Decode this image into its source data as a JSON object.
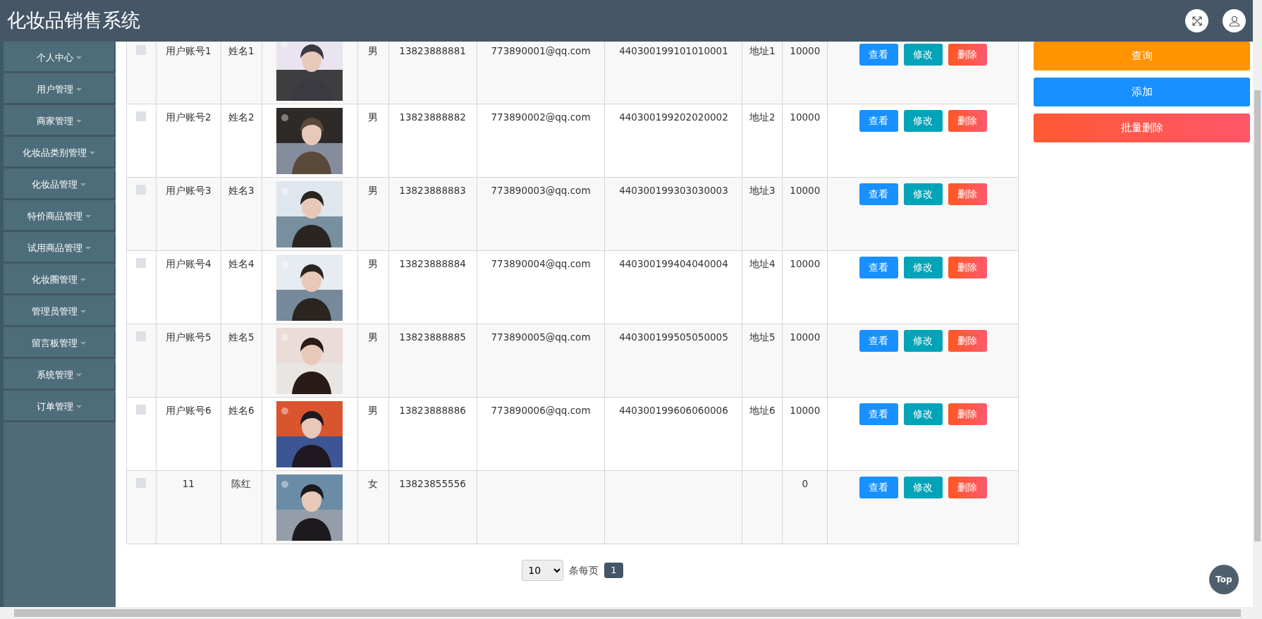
{
  "header": {
    "title": "化妆品销售系统"
  },
  "sidebar": {
    "items": [
      {
        "label": "个人中心"
      },
      {
        "label": "用户管理"
      },
      {
        "label": "商家管理"
      },
      {
        "label": "化妆品类别管理"
      },
      {
        "label": "化妆品管理"
      },
      {
        "label": "特价商品管理"
      },
      {
        "label": "试用商品管理"
      },
      {
        "label": "化妆圈管理"
      },
      {
        "label": "管理员管理"
      },
      {
        "label": "留言板管理"
      },
      {
        "label": "系统管理"
      },
      {
        "label": "订单管理"
      }
    ]
  },
  "table": {
    "rows": [
      {
        "checked": false,
        "account": "用户账号1",
        "name": "姓名1",
        "gender": "男",
        "phone": "13823888881",
        "email": "773890001@qq.com",
        "id_number": "440300199101010001",
        "address": "地址1",
        "column_10": "10000",
        "actions": [
          {
            "label": "查看",
            "kind": "view"
          },
          {
            "label": "修改",
            "kind": "edit"
          },
          {
            "label": "删除",
            "kind": "delete"
          }
        ]
      },
      {
        "checked": false,
        "account": "用户账号2",
        "name": "姓名2",
        "gender": "男",
        "phone": "13823888882",
        "email": "773890002@qq.com",
        "id_number": "440300199202020002",
        "address": "地址2",
        "column_10": "10000",
        "actions": [
          {
            "label": "查看",
            "kind": "view"
          },
          {
            "label": "修改",
            "kind": "edit"
          },
          {
            "label": "删除",
            "kind": "delete"
          }
        ]
      },
      {
        "checked": false,
        "account": "用户账号3",
        "name": "姓名3",
        "gender": "男",
        "phone": "13823888883",
        "email": "773890003@qq.com",
        "id_number": "440300199303030003",
        "address": "地址3",
        "column_10": "10000",
        "actions": [
          {
            "label": "查看",
            "kind": "view"
          },
          {
            "label": "修改",
            "kind": "edit"
          },
          {
            "label": "删除",
            "kind": "delete"
          }
        ]
      },
      {
        "checked": false,
        "account": "用户账号4",
        "name": "姓名4",
        "gender": "男",
        "phone": "13823888884",
        "email": "773890004@qq.com",
        "id_number": "440300199404040004",
        "address": "地址4",
        "column_10": "10000",
        "actions": [
          {
            "label": "查看",
            "kind": "view"
          },
          {
            "label": "修改",
            "kind": "edit"
          },
          {
            "label": "删除",
            "kind": "delete"
          }
        ]
      },
      {
        "checked": false,
        "account": "用户账号5",
        "name": "姓名5",
        "gender": "男",
        "phone": "13823888885",
        "email": "773890005@qq.com",
        "id_number": "440300199505050005",
        "address": "地址5",
        "column_10": "10000",
        "actions": [
          {
            "label": "查看",
            "kind": "view"
          },
          {
            "label": "修改",
            "kind": "edit"
          },
          {
            "label": "删除",
            "kind": "delete"
          }
        ]
      },
      {
        "checked": false,
        "account": "用户账号6",
        "name": "姓名6",
        "gender": "男",
        "phone": "13823888886",
        "email": "773890006@qq.com",
        "id_number": "440300199606060006",
        "address": "地址6",
        "column_10": "10000",
        "actions": [
          {
            "label": "查看",
            "kind": "view"
          },
          {
            "label": "修改",
            "kind": "edit"
          },
          {
            "label": "删除",
            "kind": "delete"
          }
        ]
      },
      {
        "checked": false,
        "account": "11",
        "name": "陈红",
        "gender": "女",
        "phone": "13823855556",
        "column_10": "0",
        "actions": [
          {
            "label": "查看",
            "kind": "view"
          },
          {
            "label": "修改",
            "kind": "edit"
          },
          {
            "label": "删除",
            "kind": "delete"
          }
        ]
      }
    ]
  },
  "toolbar": [
    {
      "label": "查询",
      "kind": "search"
    },
    {
      "label": "添加",
      "kind": "add"
    },
    {
      "label": "批量删除",
      "kind": "batch-delete"
    }
  ],
  "pagination": {
    "page_size": "10",
    "per_page_label": "条每页",
    "pages": [
      {
        "label": "1",
        "selected": true
      }
    ]
  },
  "back_to_top": {
    "label": "Top"
  }
}
